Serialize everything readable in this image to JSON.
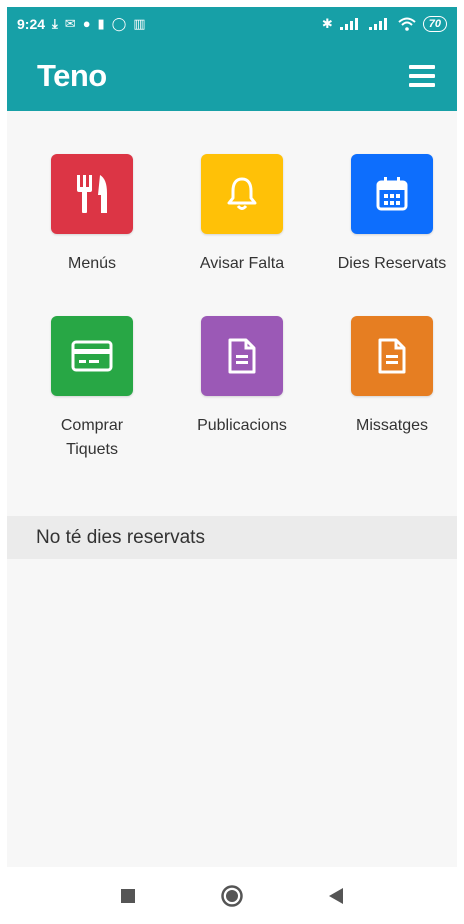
{
  "status_bar": {
    "time": "9:24",
    "battery": "70"
  },
  "app_bar": {
    "title": "Teno",
    "menu_icon": "hamburger-menu-icon"
  },
  "tiles": [
    {
      "label": "Menús",
      "icon": "utensils-icon",
      "color": "#dc3545"
    },
    {
      "label": "Avisar Falta",
      "icon": "bell-icon",
      "color": "#ffc107"
    },
    {
      "label": "Dies Reservats",
      "icon": "calendar-icon",
      "color": "#0d6efd"
    },
    {
      "label": "Comprar Tiquets",
      "icon": "credit-card-icon",
      "color": "#28a745"
    },
    {
      "label": "Publicacions",
      "icon": "document-icon",
      "color": "#9b59b6"
    },
    {
      "label": "Missatges",
      "icon": "document-icon",
      "color": "#e67e22"
    }
  ],
  "banner": {
    "text": "No té dies reservats"
  },
  "colors": {
    "primary": "#17a0a7"
  }
}
